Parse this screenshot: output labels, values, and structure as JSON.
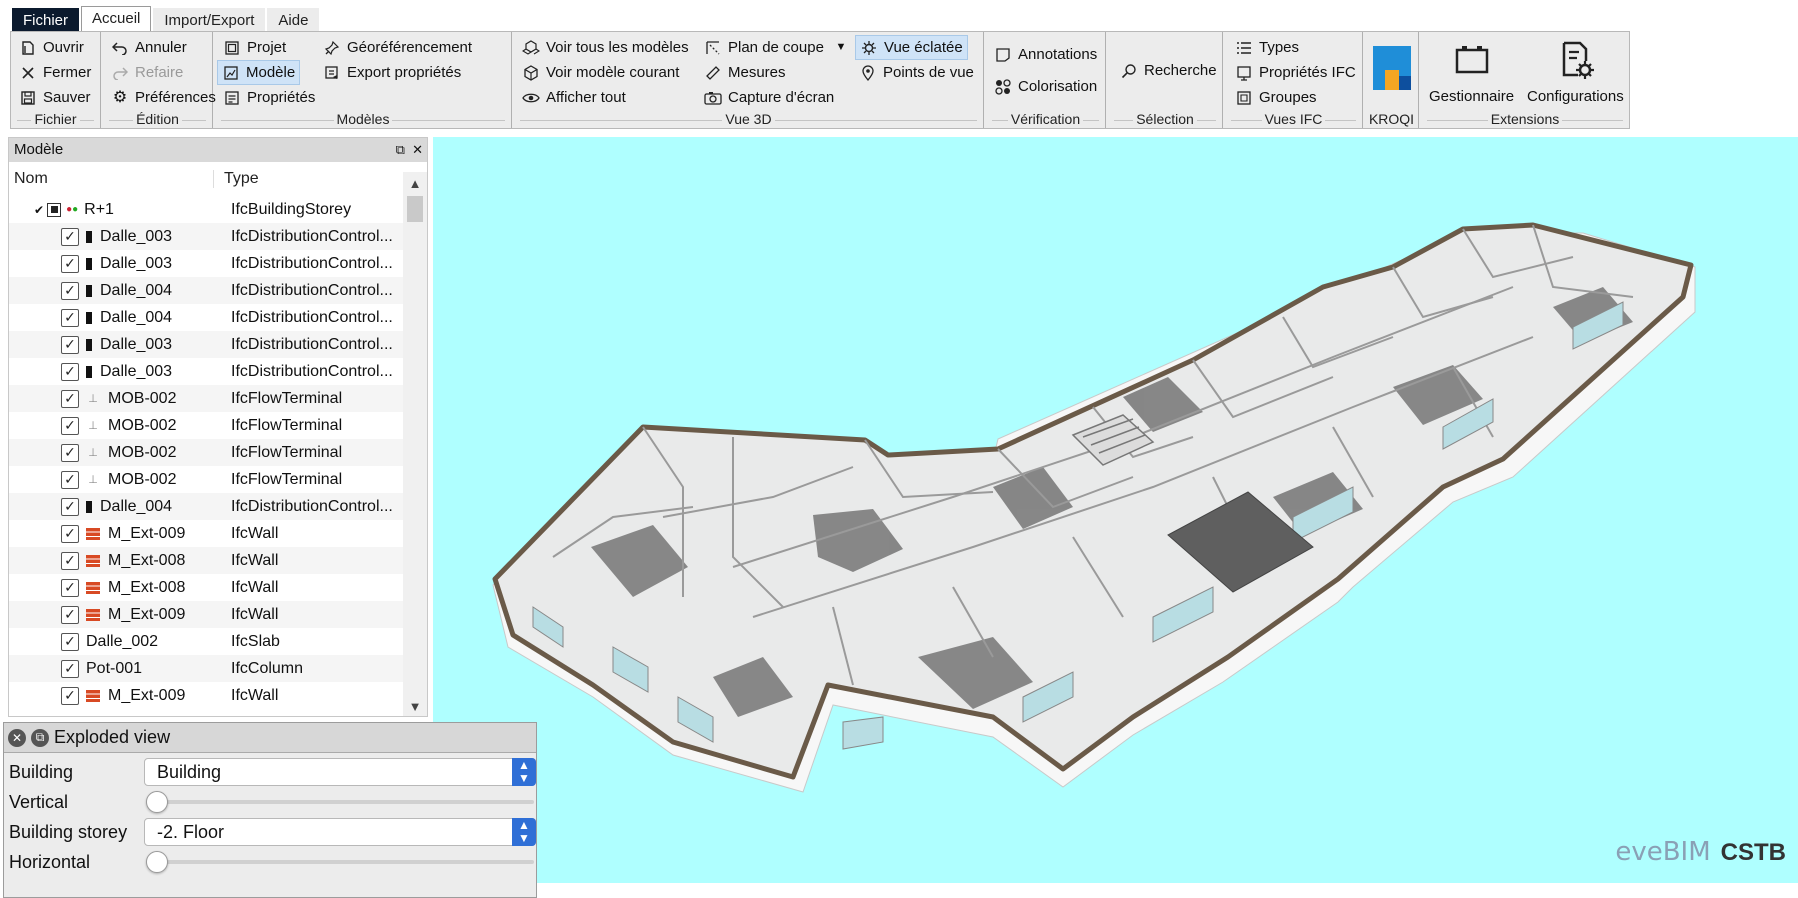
{
  "menu": {
    "tabs": [
      "Fichier",
      "Accueil",
      "Import/Export",
      "Aide"
    ],
    "active_tab": "Accueil"
  },
  "ribbon": {
    "fichier": {
      "label": "Fichier",
      "items": [
        "Ouvrir",
        "Fermer",
        "Sauver"
      ]
    },
    "edition": {
      "label": "Édition",
      "items": [
        "Annuler",
        "Refaire",
        "Préférences"
      ]
    },
    "modeles": {
      "label": "Modèles",
      "items": [
        "Projet",
        "Modèle",
        "Propriétés",
        "Géoréférencement",
        "Export propriétés"
      ]
    },
    "vue3d": {
      "label": "Vue 3D",
      "items": [
        "Voir tous les modèles",
        "Voir modèle courant",
        "Afficher tout",
        "Plan de coupe",
        "Mesures",
        "Capture d'écran",
        "Vue éclatée",
        "Points de vue"
      ]
    },
    "verification": {
      "label": "Vérification",
      "items": [
        "Annotations",
        "Colorisation"
      ]
    },
    "selection": {
      "label": "Sélection",
      "items": [
        "Recherche"
      ]
    },
    "vues_ifc": {
      "label": "Vues IFC",
      "items": [
        "Types",
        "Propriétés IFC",
        "Groupes"
      ]
    },
    "kroqi": {
      "label": "KROQI"
    },
    "extensions": {
      "label": "Extensions",
      "items": [
        "Gestionnaire",
        "Configurations"
      ]
    }
  },
  "model_panel": {
    "title": "Modèle",
    "columns": [
      "Nom",
      "Type"
    ],
    "root": {
      "name": "R+1",
      "type": "IfcBuildingStorey"
    },
    "rows": [
      {
        "name": "Dalle_003",
        "type": "IfcDistributionControl...",
        "icon": "dark"
      },
      {
        "name": "Dalle_003",
        "type": "IfcDistributionControl...",
        "icon": "dark"
      },
      {
        "name": "Dalle_004",
        "type": "IfcDistributionControl...",
        "icon": "dark"
      },
      {
        "name": "Dalle_004",
        "type": "IfcDistributionControl...",
        "icon": "dark"
      },
      {
        "name": "Dalle_003",
        "type": "IfcDistributionControl...",
        "icon": "dark"
      },
      {
        "name": "Dalle_003",
        "type": "IfcDistributionControl...",
        "icon": "dark"
      },
      {
        "name": "MOB-002",
        "type": "IfcFlowTerminal",
        "icon": "flow"
      },
      {
        "name": "MOB-002",
        "type": "IfcFlowTerminal",
        "icon": "flow"
      },
      {
        "name": "MOB-002",
        "type": "IfcFlowTerminal",
        "icon": "flow"
      },
      {
        "name": "MOB-002",
        "type": "IfcFlowTerminal",
        "icon": "flow"
      },
      {
        "name": "Dalle_004",
        "type": "IfcDistributionControl...",
        "icon": "dark"
      },
      {
        "name": "M_Ext-009",
        "type": "IfcWall",
        "icon": "wall"
      },
      {
        "name": "M_Ext-008",
        "type": "IfcWall",
        "icon": "wall"
      },
      {
        "name": "M_Ext-008",
        "type": "IfcWall",
        "icon": "wall"
      },
      {
        "name": "M_Ext-009",
        "type": "IfcWall",
        "icon": "wall"
      },
      {
        "name": "Dalle_002",
        "type": "IfcSlab",
        "icon": "none"
      },
      {
        "name": "Pot-001",
        "type": "IfcColumn",
        "icon": "none"
      },
      {
        "name": "M_Ext-009",
        "type": "IfcWall",
        "icon": "wall"
      }
    ]
  },
  "exploded_view": {
    "title": "Exploded view",
    "building_label": "Building",
    "building_value": "Building",
    "vertical_label": "Vertical",
    "vertical_value": 0,
    "storey_label": "Building storey",
    "storey_value": "-2. Floor",
    "horizontal_label": "Horizontal",
    "horizontal_value": 0
  },
  "viewport": {
    "background": "#afffff",
    "logo_left": "eveBIM",
    "logo_right": "CSTB"
  },
  "colors": {
    "accent": "#2f6fd6",
    "selected": "#cfe3f7",
    "wall_icon": "#d84a24"
  }
}
